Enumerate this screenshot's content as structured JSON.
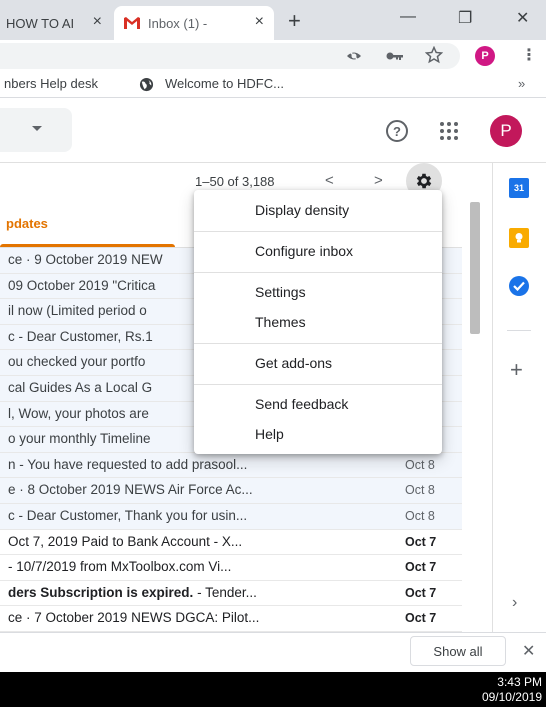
{
  "browser": {
    "tabs": [
      {
        "title": "HOW TO AI",
        "close": "×"
      },
      {
        "title": "Inbox (1) - ",
        "close": "×"
      }
    ],
    "new_tab": "+",
    "window_controls": {
      "minimize": "—",
      "restore": "❐",
      "close": "✕"
    },
    "toolbar_icons": [
      "eye-icon",
      "key-icon",
      "star-icon"
    ],
    "profile_letter": "P",
    "menu_icon": "⋮",
    "bookmarks": [
      {
        "label": "nbers Help desk"
      },
      {
        "label": "Welcome to HDFC..."
      }
    ],
    "bookmarks_overflow": "»"
  },
  "gmail": {
    "header": {
      "help_symbol": "?",
      "avatar_letter": "P",
      "avatar_color": "#c2185b"
    },
    "toolbar": {
      "page_count": "1–50 of 3,188",
      "prev": "<",
      "next": ">"
    },
    "category_tab": {
      "label": "pdates",
      "color": "#e37400"
    },
    "emails": [
      {
        "snippet": "ce · 9 October 2019 NEW",
        "date": "",
        "unread": false
      },
      {
        "snippet": "09 October 2019 \"Critica",
        "date": "",
        "unread": false
      },
      {
        "snippet": "il now (Limited period o",
        "date": "",
        "unread": false
      },
      {
        "snippet": "c - Dear Customer, Rs.1",
        "date": "",
        "unread": false
      },
      {
        "snippet": "ou checked your portfo",
        "date": "",
        "unread": false
      },
      {
        "snippet": "cal Guides As a Local G",
        "date": "",
        "unread": false
      },
      {
        "snippet": "l, Wow, your photos are",
        "date": "",
        "unread": false
      },
      {
        "snippet": "o your monthly Timeline",
        "date": "",
        "unread": false
      },
      {
        "snippet": "n - You have requested to add prasool...",
        "date": "Oct 8",
        "unread": false
      },
      {
        "snippet": "e · 8 October 2019 NEWS Air Force Ac...",
        "date": "Oct 8",
        "unread": false
      },
      {
        "snippet": "c - Dear Customer, Thank you for usin...",
        "date": "Oct 8",
        "unread": false
      },
      {
        "snippet": " Oct 7, 2019 Paid to Bank Account - X...",
        "date": "Oct 7",
        "unread": true
      },
      {
        "snippet": "- 10/7/2019 from MxToolbox.com Vi...",
        "date": "Oct 7",
        "unread": true
      },
      {
        "snippet_bold": "ders Subscription is expired.",
        "snippet": " - Tender...",
        "date": "Oct 7",
        "unread": true
      },
      {
        "snippet": "ce · 7 October 2019 NEWS DGCA: Pilot...",
        "date": "Oct 7",
        "unread": true
      }
    ],
    "settings_menu": [
      {
        "label": "Display density"
      },
      {
        "label": "Configure inbox"
      },
      {
        "label": "Settings"
      },
      {
        "label": "Themes"
      },
      {
        "label": "Get add-ons"
      },
      {
        "label": "Send feedback"
      },
      {
        "label": "Help"
      }
    ],
    "side_panel": {
      "calendar_label": "31",
      "add": "+",
      "expand": "›"
    }
  },
  "download_bar": {
    "show_all": "Show all",
    "close": "✕"
  },
  "taskbar": {
    "time": "3:43 PM",
    "date": "09/10/2019"
  }
}
